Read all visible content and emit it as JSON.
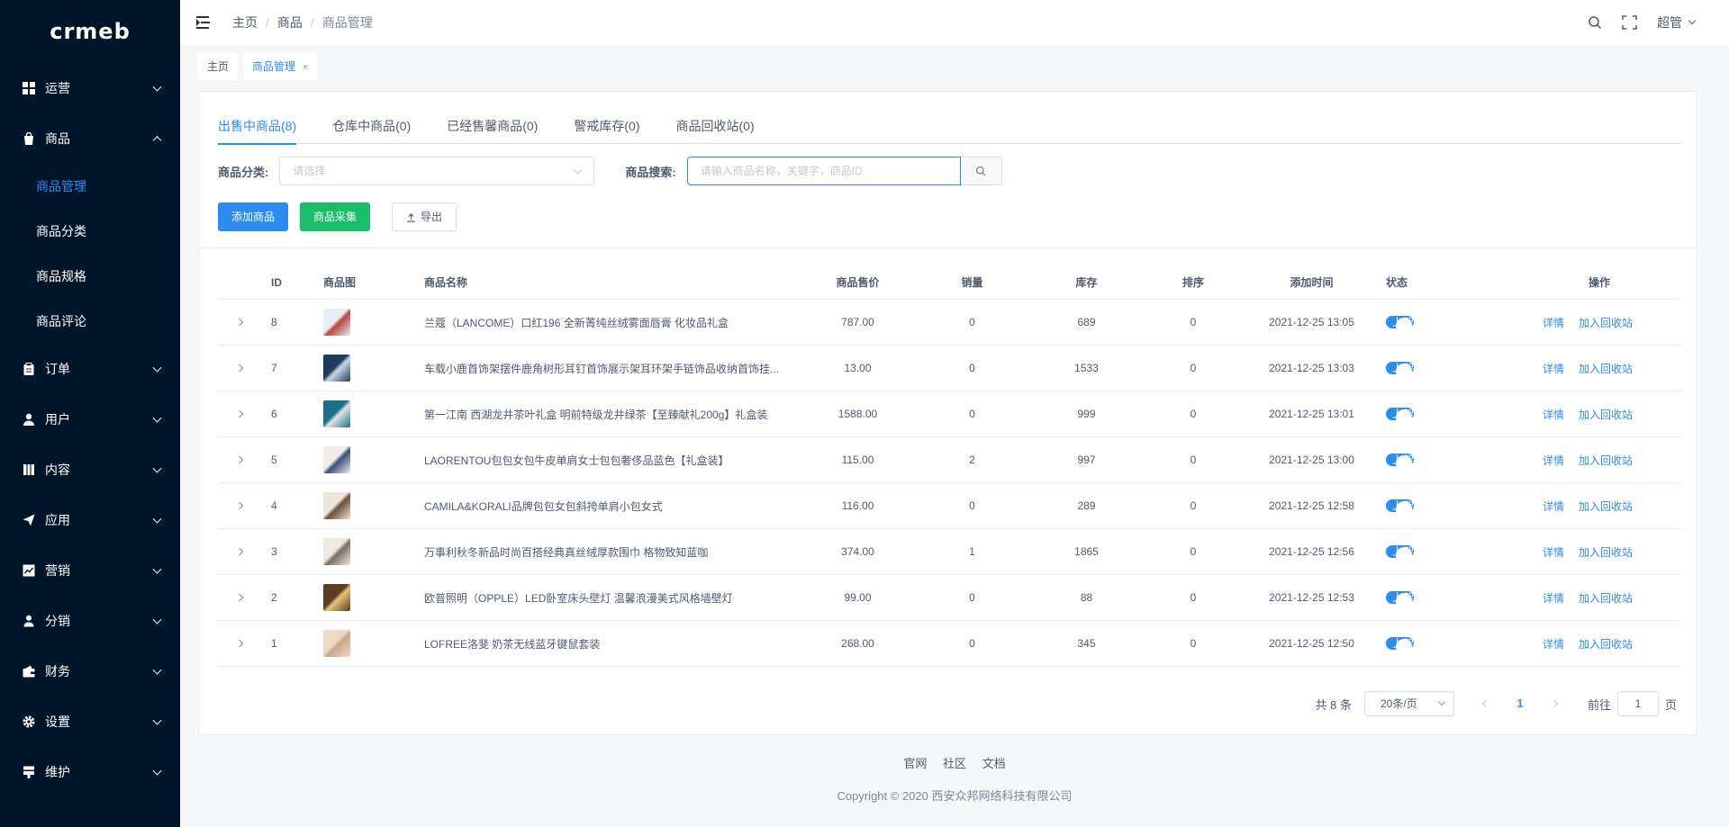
{
  "logo": "crmeb",
  "sidebar": {
    "menus": [
      {
        "label": "运营",
        "icon": "grid-icon",
        "open": false
      },
      {
        "label": "商品",
        "icon": "bag-icon",
        "open": true,
        "children": [
          "商品管理",
          "商品分类",
          "商品规格",
          "商品评论"
        ],
        "active_child": 0
      },
      {
        "label": "订单",
        "icon": "clipboard-icon",
        "open": false
      },
      {
        "label": "用户",
        "icon": "user-icon",
        "open": false
      },
      {
        "label": "内容",
        "icon": "book-icon",
        "open": false
      },
      {
        "label": "应用",
        "icon": "send-icon",
        "open": false
      },
      {
        "label": "营销",
        "icon": "chart-icon",
        "open": false
      },
      {
        "label": "分销",
        "icon": "person-icon",
        "open": false
      },
      {
        "label": "财务",
        "icon": "wallet-icon",
        "open": false
      },
      {
        "label": "设置",
        "icon": "gear-icon",
        "open": false
      },
      {
        "label": "维护",
        "icon": "tool-icon",
        "open": false
      }
    ]
  },
  "header": {
    "breadcrumb": [
      "主页",
      "商品",
      "商品管理"
    ],
    "user": "超管"
  },
  "tags": [
    {
      "label": "主页",
      "active": false
    },
    {
      "label": "商品管理",
      "active": true,
      "close": "×"
    }
  ],
  "tabs": [
    "出售中商品(8)",
    "仓库中商品(0)",
    "已经售馨商品(0)",
    "警戒库存(0)",
    "商品回收站(0)"
  ],
  "filters": {
    "category_label": "商品分类:",
    "category_placeholder": "请选择",
    "search_label": "商品搜索:",
    "search_placeholder": "请输入商品名称，关键字，商品ID"
  },
  "buttons": {
    "add": "添加商品",
    "collect": "商品采集",
    "export": "导出"
  },
  "table": {
    "columns": [
      "ID",
      "商品图",
      "商品名称",
      "商品售价",
      "销量",
      "库存",
      "排序",
      "添加时间",
      "状态",
      "操作"
    ],
    "status_label": "上架",
    "op_detail": "详情",
    "op_recycle": "加入回收站",
    "rows": [
      {
        "id": "8",
        "name": "兰蔻（LANCOME）口红196 全新菁纯丝绒雾面唇膏 化妆品礼盒",
        "price": "787.00",
        "sales": "0",
        "stock": "689",
        "sort": "0",
        "time": "2021-12-25 13:05",
        "thumb": [
          "#e9eef5",
          "#b8463f"
        ]
      },
      {
        "id": "7",
        "name": "车载小鹿首饰架摆件鹿角树形耳钉首饰展示架耳环架手链饰品收纳首饰挂...",
        "price": "13.00",
        "sales": "0",
        "stock": "1533",
        "sort": "0",
        "time": "2021-12-25 13:03",
        "thumb": [
          "#1f3a5c",
          "#c9d6e6"
        ]
      },
      {
        "id": "6",
        "name": "第一江南 西湖龙井茶叶礼盒 明前特级龙井绿茶【至臻献礼200g】礼盒装",
        "price": "1588.00",
        "sales": "0",
        "stock": "999",
        "sort": "0",
        "time": "2021-12-25 13:01",
        "thumb": [
          "#1a6f8a",
          "#e3e3e3"
        ]
      },
      {
        "id": "5",
        "name": "LAORENTOU包包女包牛皮单肩女士包包奢侈品蓝色【礼盒装】",
        "price": "115.00",
        "sales": "2",
        "stock": "997",
        "sort": "0",
        "time": "2021-12-25 13:00",
        "thumb": [
          "#f0ece8",
          "#3a4f7a"
        ]
      },
      {
        "id": "4",
        "name": "CAMILA&KORALI品牌包包女包斜挎单肩小包女式",
        "price": "116.00",
        "sales": "0",
        "stock": "289",
        "sort": "0",
        "time": "2021-12-25 12:58",
        "thumb": [
          "#eee6dc",
          "#6b4f3a"
        ]
      },
      {
        "id": "3",
        "name": "万事利秋冬新品时尚百搭经典真丝绒厚款围巾 格物致知蓝咖",
        "price": "374.00",
        "sales": "1",
        "stock": "1865",
        "sort": "0",
        "time": "2021-12-25 12:56",
        "thumb": [
          "#ece9e2",
          "#7a6e62"
        ]
      },
      {
        "id": "2",
        "name": "欧普照明（OPPLE）LED卧室床头壁灯 温馨浪漫美式风格墙壁灯",
        "price": "99.00",
        "sales": "0",
        "stock": "88",
        "sort": "0",
        "time": "2021-12-25 12:53",
        "thumb": [
          "#5a3d22",
          "#e8c27a"
        ]
      },
      {
        "id": "1",
        "name": "LOFREE洛斐 奶茶无线蓝牙键鼠套装",
        "price": "268.00",
        "sales": "0",
        "stock": "345",
        "sort": "0",
        "time": "2021-12-25 12:50",
        "thumb": [
          "#efd9c2",
          "#c9a48a"
        ]
      }
    ]
  },
  "pagination": {
    "total": "共 8 条",
    "page_size": "20条/页",
    "current": "1",
    "goto_prefix": "前往",
    "goto_value": "1",
    "goto_suffix": "页"
  },
  "footer": {
    "links": [
      "官网",
      "社区",
      "文档"
    ],
    "copyright": "Copyright © 2020 西安众邦网络科技有限公司"
  },
  "colors": {
    "sidebar_bg": "#001529",
    "primary": "#2d8cf0",
    "success": "#19be6b"
  }
}
